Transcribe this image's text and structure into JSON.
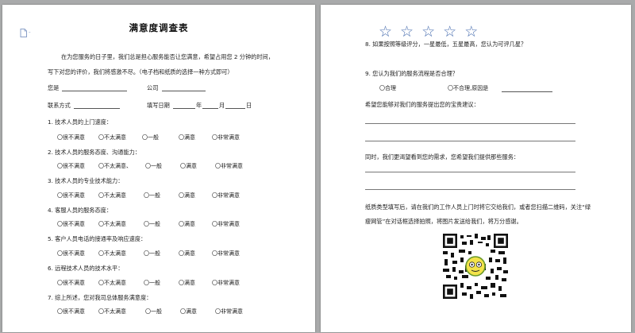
{
  "page1": {
    "title": "满意度调查表",
    "intro_line1": "在为您服务的日子里，我们总是担心服务能否让您满意，希望占用您 2 分钟的时间，",
    "intro_line2": "写下对您的评价，我们将感激不尽。（电子档和纸质的选择一种方式即可）",
    "name_label": "您是",
    "company_label": "公司",
    "contact_label": "联系方式",
    "date_label": "填写日期",
    "year": "年",
    "month": "月",
    "day": "日",
    "questions": [
      {
        "label": "1.    技术人员的上门速度：",
        "options": [
          "〇很不满意",
          "〇不太满意",
          "〇一般",
          "〇满意",
          "〇非常满意"
        ]
      },
      {
        "label": "2.    技术人员的服务态度、沟通能力：",
        "options": [
          "〇很不满意",
          "〇不太满意、",
          "〇一般",
          "〇满意",
          "〇非常满意"
        ]
      },
      {
        "label": "3.    技术人员的专业技术能力：",
        "options": [
          "〇很不满意",
          "〇不太满意",
          "〇一般",
          "〇满意",
          "〇非常满意"
        ]
      },
      {
        "label": "4.    客服人员的服务态度：",
        "options": [
          "〇很不满意",
          "〇不太满意",
          "〇一般",
          "〇满意",
          "〇非常满意"
        ]
      },
      {
        "label": "5.    客户人员电话的接通率及响应速度：",
        "options": [
          "〇很不满意",
          "〇不太满意",
          "〇一般",
          "〇满意",
          "〇非常满意"
        ]
      },
      {
        "label": "6.    远程技术人员的技术水平：",
        "options": [
          "〇很不满意",
          "〇不太满意",
          "〇一般",
          "〇满意",
          "〇非常满意"
        ]
      },
      {
        "label": "7.    综上所述，您对我司总体服务满意度：",
        "options": [
          "〇很不满意",
          "〇不太满意",
          "〇一般",
          "〇满意",
          "〇非常满意"
        ]
      }
    ]
  },
  "page2": {
    "stars": [
      "☆",
      "☆",
      "☆",
      "☆",
      "☆"
    ],
    "q8": "8.    如果按照等级评分，一星最低，五星最高，您认为可评几星？",
    "q9": "9.    您认为我们的服务流程是否合理？",
    "q9_opt1": "〇合理",
    "q9_opt2": "〇不合理,原因是",
    "suggestion_label": "希望您能够对我们的服务提出您的宝贵建议：",
    "needs_label": "同时，我们更渴望看到您的需求，您希望我们提供那些服务：",
    "footer_line1": "纸质类型填写后，请在我们的工作人员上门时将它交给我们，或者您扫描二维码，关注“绿",
    "footer_line2": "瘦网管”在对话框选择拍照，将图片发送给我们，将万分感谢。"
  }
}
